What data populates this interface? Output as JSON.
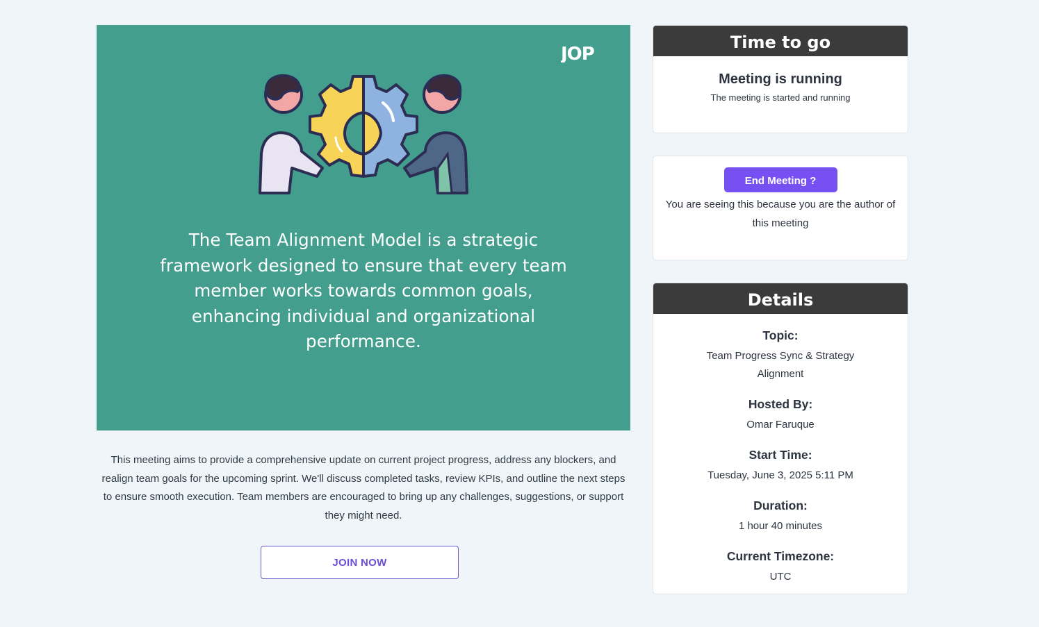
{
  "banner": {
    "logo_text": "JOP",
    "description": "The Team Alignment Model is a strategic framework designed to ensure that every team member works towards common goals, enhancing individual and organizational performance."
  },
  "meeting": {
    "description": "This meeting aims to provide a comprehensive update on current project progress, address any blockers, and realign team goals for the upcoming sprint. We'll discuss completed tasks, review KPIs, and outline the next steps to ensure smooth execution. Team members are encouraged to bring up any challenges, suggestions, or support they might need.",
    "join_label": "JOIN NOW"
  },
  "time_card": {
    "title": "Time to go",
    "status": "Meeting is running",
    "status_sub": "The meeting is started and running"
  },
  "end_card": {
    "button_label": "End Meeting ?",
    "note": "You are seeing this because you are the author of this meeting"
  },
  "details": {
    "title": "Details",
    "items": [
      {
        "label": "Topic:",
        "value": "Team Progress Sync & Strategy Alignment"
      },
      {
        "label": "Hosted By:",
        "value": "Omar Faruque"
      },
      {
        "label": "Start Time:",
        "value": "Tuesday, June 3, 2025 5:11 PM"
      },
      {
        "label": "Duration:",
        "value": "1 hour 40 minutes"
      },
      {
        "label": "Current Timezone:",
        "value": "UTC"
      }
    ]
  },
  "colors": {
    "banner_bg": "#439e8e",
    "accent": "#7650f2",
    "header_bg": "#3b3b3b",
    "page_bg": "#f0f5f9"
  },
  "icons": [
    "jop-logo-icon",
    "team-gear-illustration-icon"
  ]
}
